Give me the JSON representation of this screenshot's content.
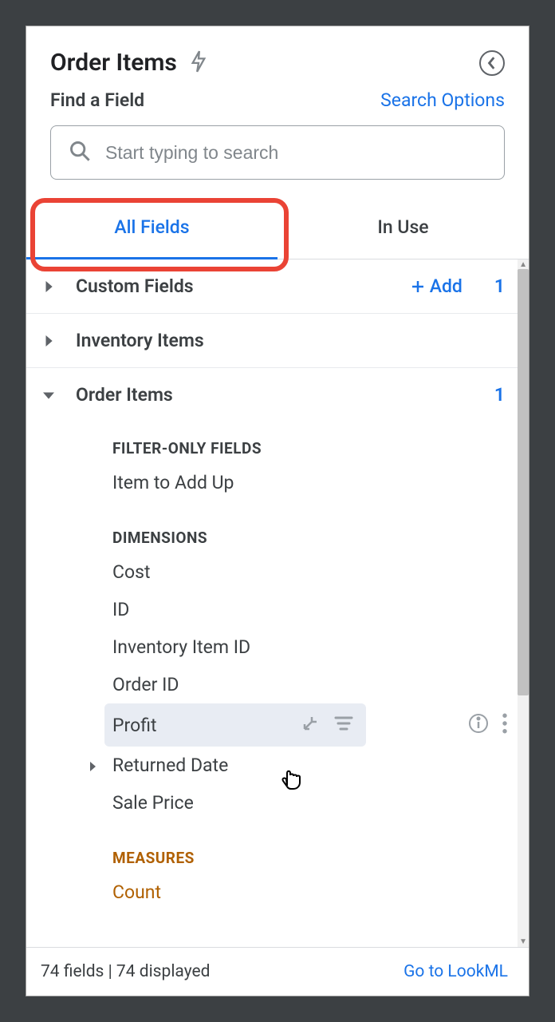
{
  "panel": {
    "title": "Order Items"
  },
  "search": {
    "find_label": "Find a Field",
    "options_label": "Search Options",
    "placeholder": "Start typing to search"
  },
  "tabs": {
    "all_fields": "All Fields",
    "in_use": "In Use"
  },
  "sections": {
    "custom_fields": {
      "label": "Custom Fields",
      "add_label": "Add",
      "count": "1"
    },
    "inventory_items": {
      "label": "Inventory Items"
    },
    "order_items": {
      "label": "Order Items",
      "count": "1"
    }
  },
  "groups": {
    "filter_only": "FILTER-ONLY FIELDS",
    "dimensions": "DIMENSIONS",
    "measures": "MEASURES"
  },
  "fields": {
    "item_to_add_up": "Item to Add Up",
    "cost": "Cost",
    "id": "ID",
    "inventory_item_id": "Inventory Item ID",
    "order_id": "Order ID",
    "profit": "Profit",
    "returned_date": "Returned Date",
    "sale_price": "Sale Price",
    "count": "Count"
  },
  "footer": {
    "status": "74 fields | 74 displayed",
    "link": "Go to LookML"
  }
}
